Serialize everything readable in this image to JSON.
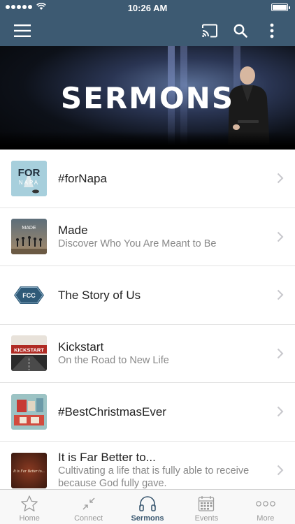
{
  "status_bar": {
    "time": "10:26 AM"
  },
  "nav": {
    "menu_icon": "hamburger-icon",
    "cast_icon": "cast-icon",
    "search_icon": "search-icon",
    "more_icon": "more-vertical-icon"
  },
  "hero": {
    "title": "SERMONS"
  },
  "series": [
    {
      "title": "#forNapa",
      "subtitle": "",
      "thumb_text": "FOR",
      "thumb_text2": "NAPA"
    },
    {
      "title": "Made",
      "subtitle": "Discover Who You Are Meant to Be",
      "thumb_text": "MADE"
    },
    {
      "title": "The Story of Us",
      "subtitle": "",
      "thumb_text": "FCC"
    },
    {
      "title": "Kickstart",
      "subtitle": "On the Road to New Life",
      "thumb_text": "KICKSTART"
    },
    {
      "title": "#BestChristmasEver",
      "subtitle": ""
    },
    {
      "title": "It is Far Better to...",
      "subtitle": "Cultivating a life that is fully able to receive because God fully gave.",
      "thumb_text": "It is Far Better to..."
    }
  ],
  "tabs": [
    {
      "label": "Home",
      "icon": "star-icon"
    },
    {
      "label": "Connect",
      "icon": "connect-icon"
    },
    {
      "label": "Sermons",
      "icon": "headphones-icon"
    },
    {
      "label": "Events",
      "icon": "calendar-icon"
    },
    {
      "label": "More",
      "icon": "more-horizontal-icon"
    }
  ],
  "colors": {
    "nav_bg": "#3d5a72",
    "active_tab": "#3d5a72",
    "inactive_tab": "#9a9a9a"
  }
}
